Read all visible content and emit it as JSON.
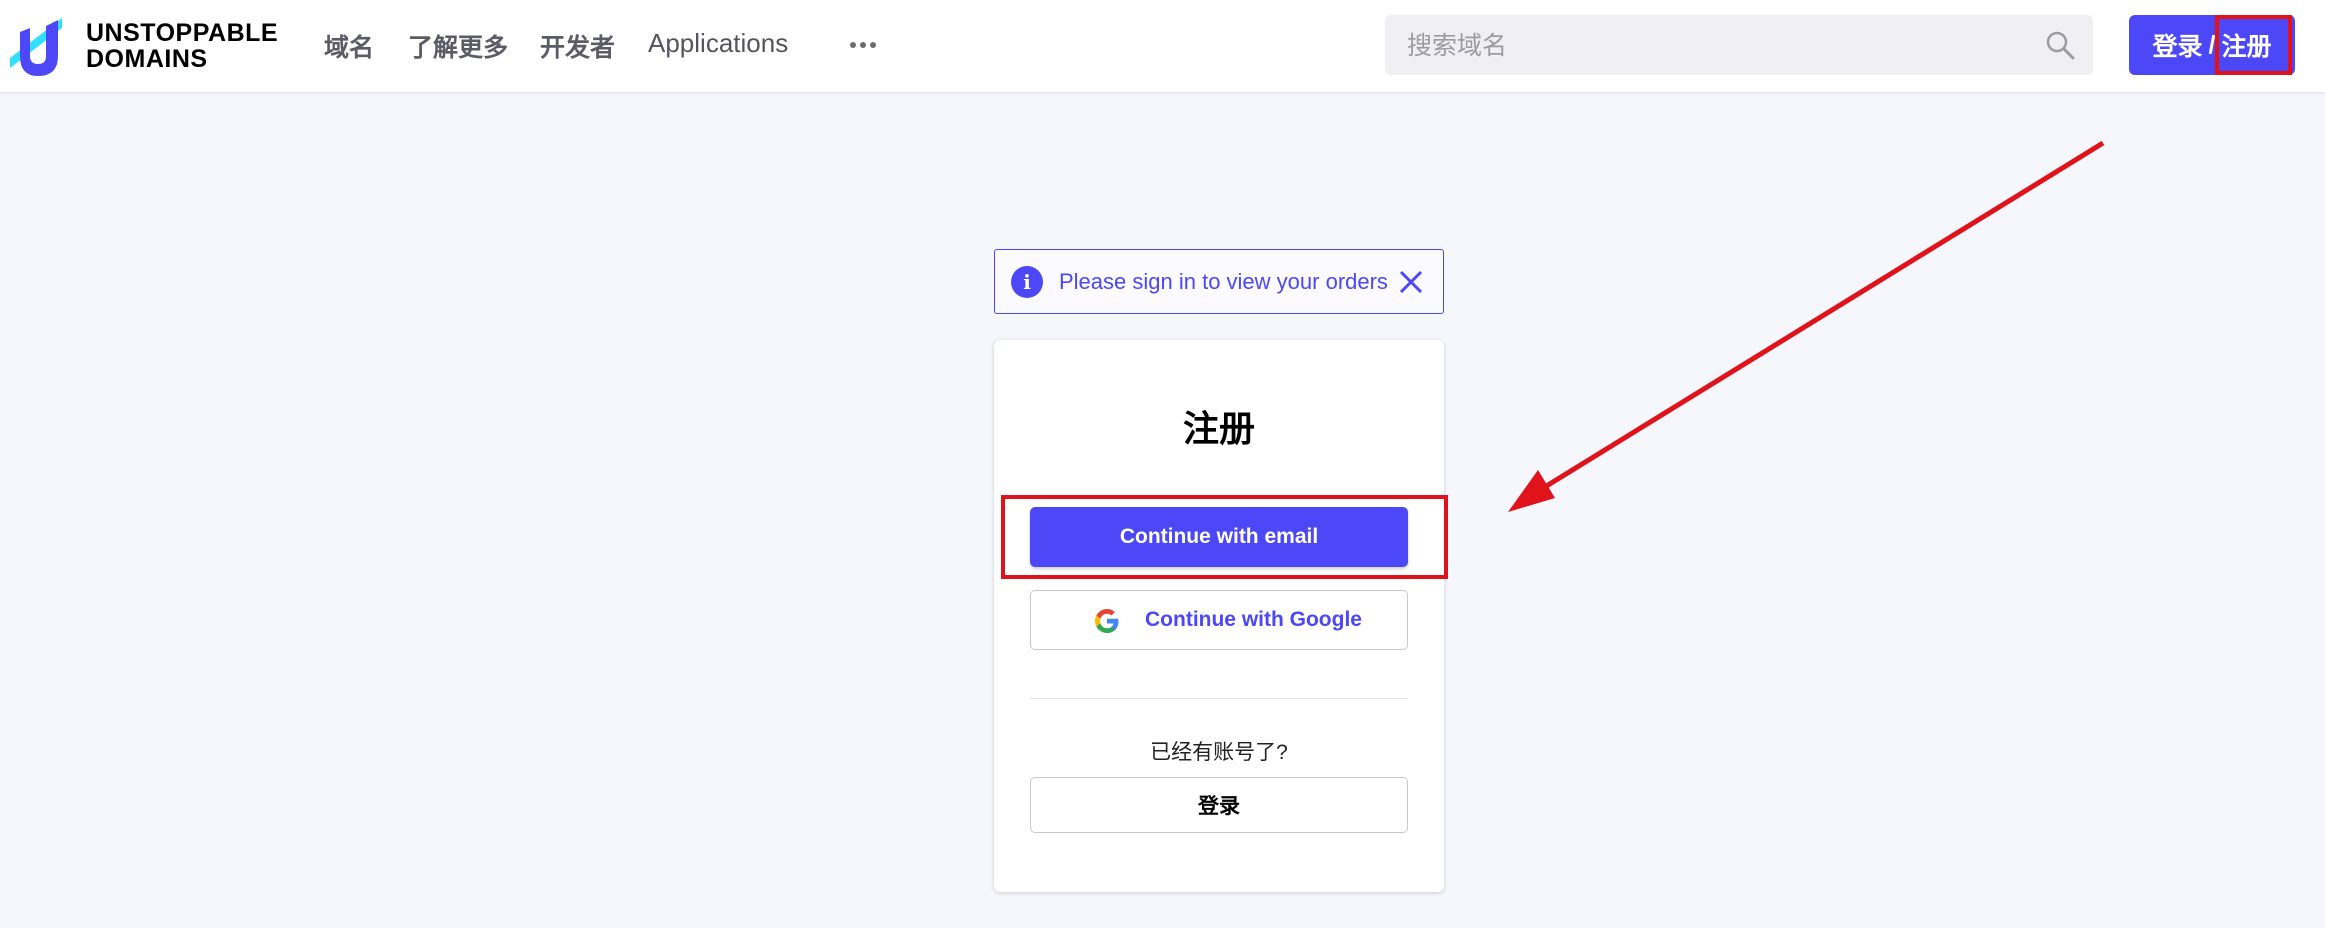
{
  "header": {
    "logo": {
      "line1": "UNSTOPPABLE",
      "line2": "DOMAINS"
    },
    "nav": [
      "域名",
      "了解更多",
      "开发者",
      "Applications"
    ],
    "more_icon": "more-horizontal-icon",
    "search": {
      "placeholder": "搜索域名",
      "icon": "search-icon"
    },
    "auth_button": {
      "login": "登录",
      "separator": "/",
      "register": "注册"
    }
  },
  "alert": {
    "icon": "info-icon",
    "message": "Please sign in to view your orders",
    "close_icon": "close-icon"
  },
  "card": {
    "title": "注册",
    "email_button": "Continue with email",
    "google_button": "Continue with Google",
    "have_account": "已经有账号了?",
    "login_button": "登录"
  },
  "annotations": {
    "color": "#e0131a",
    "arrow_icon": "red-arrow"
  },
  "colors": {
    "accent": "#4c47f7",
    "background": "#f6f7fc"
  }
}
